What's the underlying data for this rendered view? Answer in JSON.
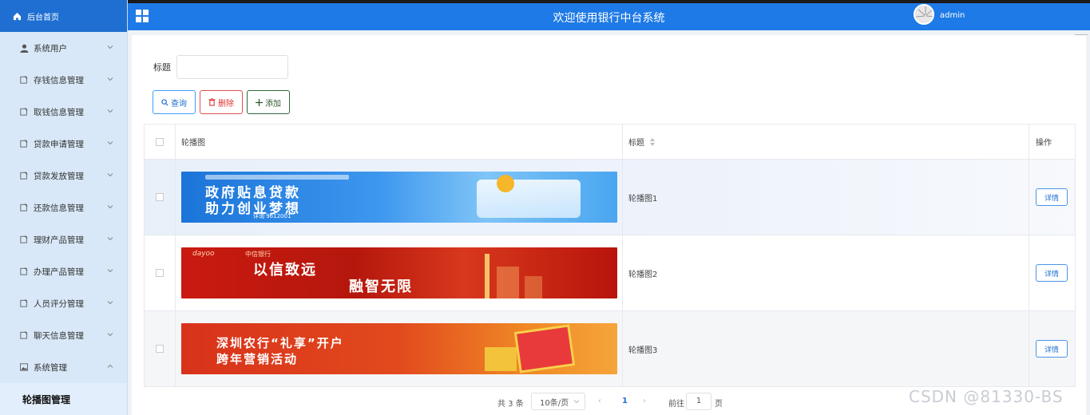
{
  "header": {
    "title": "欢迎使用银行中台系统",
    "user": "admin"
  },
  "sidebar": {
    "home": "后台首页",
    "items": [
      {
        "label": "系统用户",
        "icon": "user-icon"
      },
      {
        "label": "存钱信息管理",
        "icon": "doc-icon"
      },
      {
        "label": "取钱信息管理",
        "icon": "doc-icon"
      },
      {
        "label": "贷款申请管理",
        "icon": "doc-icon"
      },
      {
        "label": "贷款发放管理",
        "icon": "doc-icon"
      },
      {
        "label": "还款信息管理",
        "icon": "doc-icon"
      },
      {
        "label": "理财产品管理",
        "icon": "doc-icon"
      },
      {
        "label": "办理产品管理",
        "icon": "doc-icon"
      },
      {
        "label": "人员评分管理",
        "icon": "doc-icon"
      },
      {
        "label": "聊天信息管理",
        "icon": "doc-icon"
      },
      {
        "label": "系统管理",
        "icon": "image-icon"
      }
    ],
    "sub_item": "轮播图管理"
  },
  "search": {
    "label": "标题",
    "value": ""
  },
  "toolbar": {
    "query": "查询",
    "delete": "删除",
    "add": "添加"
  },
  "table": {
    "headers": {
      "image": "轮播图",
      "title": "标题",
      "op": "操作"
    },
    "rows": [
      {
        "title": "轮播图1",
        "detail": "详情",
        "banner_text1": "政府贴息贷款",
        "banner_text2": "助力创业梦想",
        "banner_small": "详询 9612001"
      },
      {
        "title": "轮播图2",
        "detail": "详情",
        "banner_text1": "以信致远",
        "banner_text2": "融智无限",
        "banner_brand": "dayoo",
        "banner_bank": "中信银行"
      },
      {
        "title": "轮播图3",
        "detail": "详情",
        "banner_text1": "深圳农行“礼享”开户",
        "banner_text2": "跨年营销活动"
      }
    ]
  },
  "pager": {
    "total": "共 3 条",
    "size": "10条/页",
    "current": "1",
    "goto": "前往",
    "goto_value": "1",
    "page_suffix": "页"
  },
  "watermark": "CSDN @81330-BS",
  "colors": {
    "primary": "#1e7ae6",
    "sidebar_bg": "#d9e8f8",
    "danger": "#e05050"
  }
}
